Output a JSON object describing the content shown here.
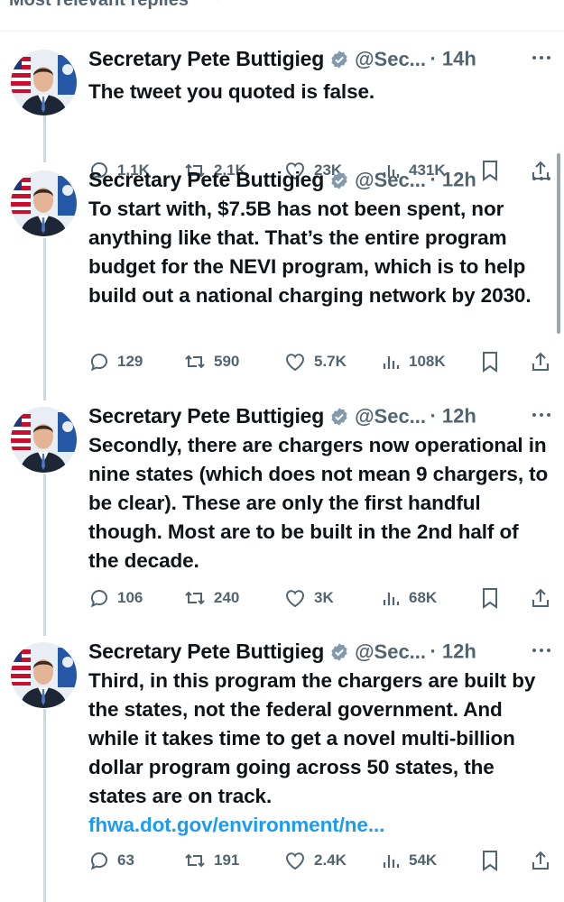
{
  "header": {
    "title": "Most relevant replies"
  },
  "tweets": [
    {
      "author": "Secretary Pete Buttigieg",
      "handle": "@Sec...",
      "time": "· 14h",
      "text": "The tweet you quoted is false.",
      "link": "",
      "replies": "1.1K",
      "reposts": "2.1K",
      "likes": "23K",
      "views": "431K"
    },
    {
      "author": "Secretary Pete Buttigieg",
      "handle": "@Sec...",
      "time": "· 12h",
      "text": "To start with, $7.5B has not been spent, nor anything like that. That’s the entire program budget for the NEVI program, which is to help build out a national charging network by 2030.",
      "link": "",
      "replies": "129",
      "reposts": "590",
      "likes": "5.7K",
      "views": "108K"
    },
    {
      "author": "Secretary Pete Buttigieg",
      "handle": "@Sec...",
      "time": "· 12h",
      "text": "Secondly, there are chargers now operational in nine states (which does not mean 9 chargers, to be clear). These are only the first handful though. Most are to be built in the 2nd half of the decade.",
      "link": "",
      "replies": "106",
      "reposts": "240",
      "likes": "3K",
      "views": "68K"
    },
    {
      "author": "Secretary Pete Buttigieg",
      "handle": "@Sec...",
      "time": "· 12h",
      "text": "Third, in this program the chargers are built by the states, not the federal government. And while it takes time to get a novel multi-billion dollar program going across 50 states, the states are on track. ",
      "link": "fhwa.dot.gov/environment/ne...",
      "replies": "63",
      "reposts": "191",
      "likes": "2.4K",
      "views": "54K"
    }
  ],
  "colors": {
    "text": "#0f1419",
    "muted": "#536471",
    "link": "#1d9bf0",
    "verified": "#829aab"
  },
  "icons": [
    "chevron-down-icon",
    "verified-badge-icon",
    "more-icon",
    "reply-icon",
    "repost-icon",
    "like-icon",
    "views-icon",
    "bookmark-icon",
    "share-icon"
  ]
}
